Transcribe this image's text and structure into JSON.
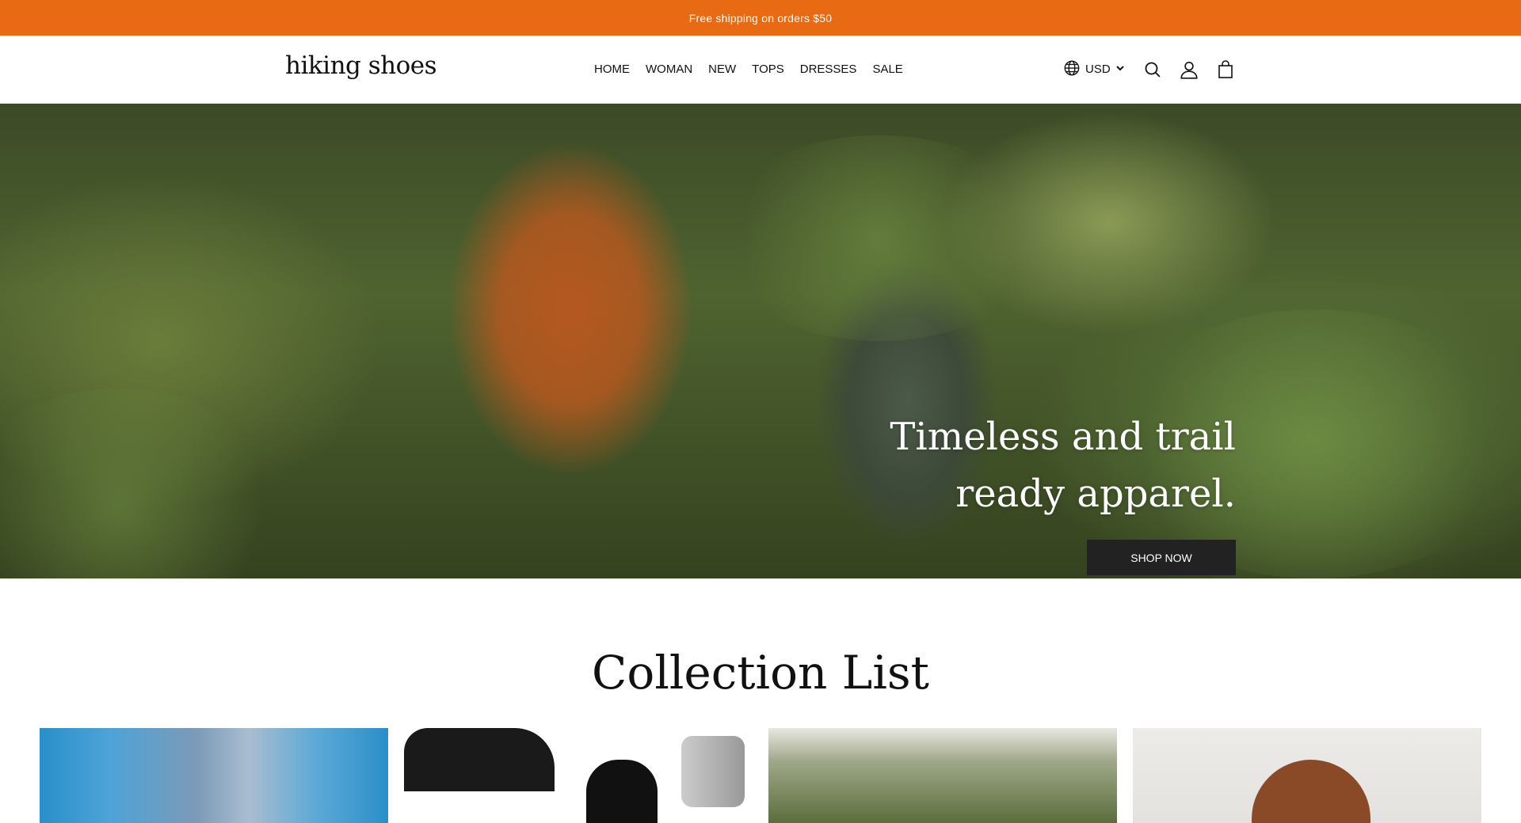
{
  "announcement": {
    "text": "Free shipping on orders $50"
  },
  "header": {
    "logo": "hiking shoes",
    "nav": [
      "HOME",
      "WOMAN",
      "NEW",
      "TOPS",
      "DRESSES",
      "SALE"
    ],
    "currency": "USD",
    "icons": [
      "globe-icon",
      "chevron-down-icon",
      "search-icon",
      "account-icon",
      "cart-icon"
    ]
  },
  "hero": {
    "title": "Timeless and trail ready apparel.",
    "button": "SHOP NOW"
  },
  "collections": {
    "title": "Collection List"
  },
  "colors": {
    "announcement_bg": "#e86a12",
    "button_bg": "#222222"
  }
}
